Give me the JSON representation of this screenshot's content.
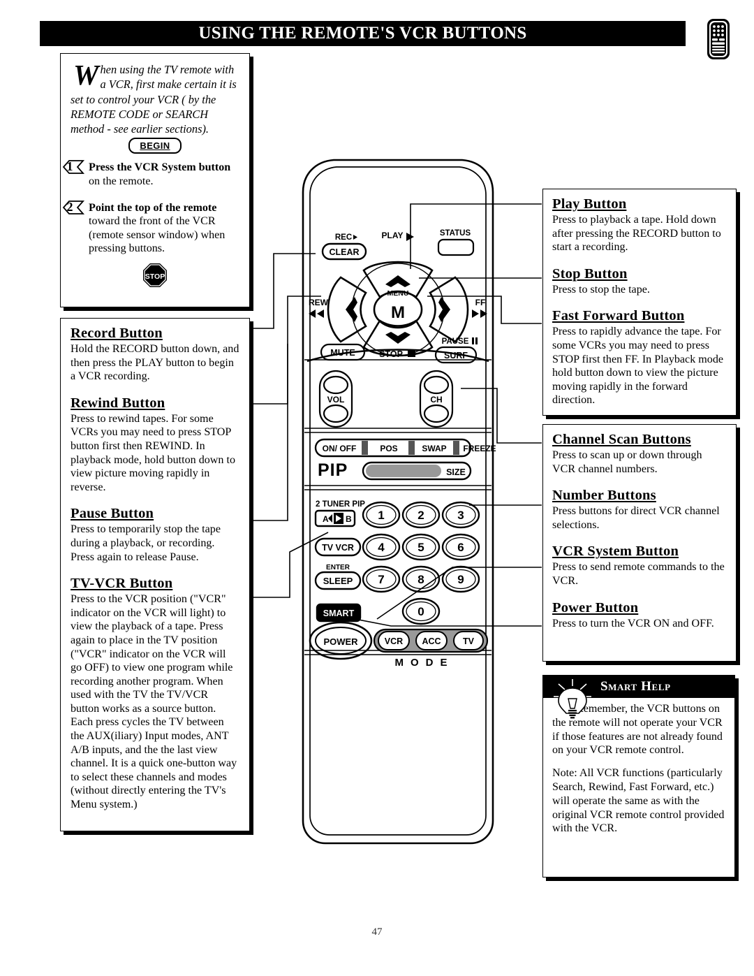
{
  "page": {
    "title": "Using the Remote's VCR Buttons",
    "number": "47",
    "header_icon": "remote-control-icon"
  },
  "intro": {
    "dropcap": "W",
    "paragraph": "hen using the TV remote with a VCR, first make certain it is set to control your VCR ( by the REMOTE CODE or SEARCH method - see earlier sections).",
    "begin_badge": "BEGIN",
    "stop_badge": "STOP",
    "steps": [
      {
        "number": "1",
        "bold": "Press the VCR System button",
        "rest": " on the remote."
      },
      {
        "number": "2",
        "bold": "Point the top of the remote",
        "rest": " toward the front of the VCR (remote sensor window) when pressing buttons."
      }
    ]
  },
  "left_callouts": [
    {
      "heading": "Record Button",
      "text": "Hold the RECORD button down, and then press the PLAY button to begin a VCR recording."
    },
    {
      "heading": "Rewind Button",
      "text": "Press to rewind tapes. For some VCRs you may need to press STOP button first then REWIND. In playback mode, hold button down to view picture moving rapidly in reverse."
    },
    {
      "heading": "Pause Button",
      "text": "Press to temporarily stop the tape during a playback, or recording. Press again to release Pause."
    },
    {
      "heading": "TV-VCR Button",
      "text": "Press to the VCR position (\"VCR\" indicator on the VCR will light) to view the playback of a tape. Press again to place in the TV position (\"VCR\" indicator on the VCR will go OFF) to view one program while recording another program. When used with the TV the TV/VCR button works as a source button. Each press cycles the TV between the AUX(iliary) Input modes, ANT A/B inputs, and the the last view channel. It is a quick one-button way to select these channels and modes (without directly entering the TV's Menu system.)"
    }
  ],
  "right_callouts_top": [
    {
      "heading": "Play Button",
      "text": "Press to playback a tape. Hold down after pressing the RECORD button to start a recording."
    },
    {
      "heading": "Stop Button",
      "text": "Press to stop the tape."
    },
    {
      "heading": "Fast Forward Button",
      "text": "Press to rapidly advance the tape. For some VCRs you may need to press STOP first then FF. In Playback mode hold button down to view the picture moving rapidly in the forward direction."
    }
  ],
  "right_callouts_bottom": [
    {
      "heading": "Channel Scan Buttons",
      "text": "Press to scan up or down through VCR channel numbers."
    },
    {
      "heading": "Number Buttons",
      "text": "Press buttons for direct VCR channel selections."
    },
    {
      "heading": "VCR System Button",
      "text": "Press to send remote commands to the VCR."
    },
    {
      "heading": "Power Button",
      "text": "Press to turn the VCR ON and OFF."
    }
  ],
  "smart_help": {
    "title": "Smart Help",
    "icon": "lightbulb-icon",
    "paragraph1": "Remember, the VCR buttons on the remote will not operate your VCR if those features are not already found on your VCR remote control.",
    "paragraph2": "Note: All VCR functions (particularly Search, Rewind, Fast Forward, etc.) will operate the same as with the original VCR remote control provided with the VCR."
  },
  "remote": {
    "labels": {
      "rec": "REC",
      "clear": "CLEAR",
      "play": "PLAY",
      "status": "STATUS",
      "rew": "REW",
      "ff": "FF",
      "menu": "MENU",
      "menu_key": "M",
      "mute": "MUTE",
      "stop": "STOP",
      "pause": "PAUSE",
      "surf": "SURF",
      "vol": "VOL",
      "ch": "CH",
      "pip_on_off": "ON/ OFF",
      "pip_pos": "POS",
      "pip_swap": "SWAP",
      "pip_freeze": "FREEZE",
      "pip": "PIP",
      "pip_size": "SIZE",
      "tuner_pip": "2 TUNER PIP",
      "ab": "A",
      "ab2": "B",
      "tv_vcr": "TV VCR",
      "enter": "ENTER",
      "sleep": "SLEEP",
      "smart": "SMART",
      "power": "POWER",
      "mode": "M O D E",
      "mode_vcr": "VCR",
      "mode_acc": "ACC",
      "mode_tv": "TV"
    },
    "keypad": [
      "1",
      "2",
      "3",
      "4",
      "5",
      "6",
      "7",
      "8",
      "9",
      "0"
    ]
  },
  "colors": {
    "ink": "#000000",
    "paper": "#ffffff",
    "shadow": "#000000",
    "pip_bar": "#999999"
  }
}
